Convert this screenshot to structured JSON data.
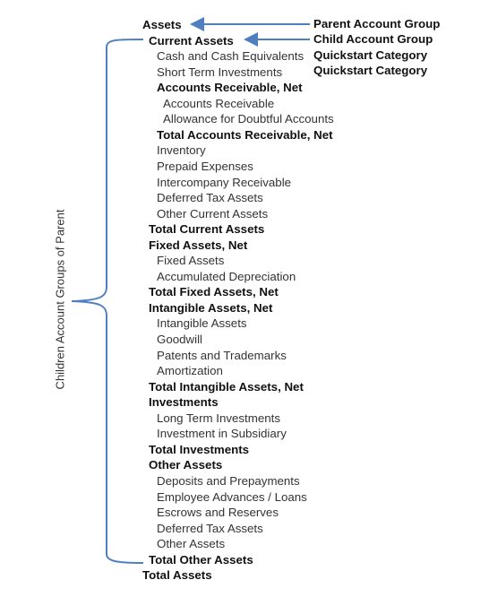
{
  "annotations": {
    "parent": "Parent Account Group",
    "child": "Child Account Group",
    "quickstart1": "Quickstart Category",
    "quickstart2": "Quickstart Category",
    "bracket_label": "Children Account Groups of Parent"
  },
  "accent_color": "#4f7fbf",
  "rows": [
    {
      "text": "Assets",
      "level": 0,
      "bold": true
    },
    {
      "text": "Current Assets",
      "level": 1,
      "bold": true
    },
    {
      "text": "Cash and Cash Equivalents",
      "level": 2,
      "bold": false
    },
    {
      "text": "Short Term Investments",
      "level": 2,
      "bold": false
    },
    {
      "text": "Accounts Receivable, Net",
      "level": 2,
      "bold": true
    },
    {
      "text": "Accounts Receivable",
      "level": 3,
      "bold": false
    },
    {
      "text": "Allowance for Doubtful Accounts",
      "level": 3,
      "bold": false
    },
    {
      "text": "Total Accounts Receivable, Net",
      "level": 2,
      "bold": true
    },
    {
      "text": "Inventory",
      "level": 2,
      "bold": false
    },
    {
      "text": "Prepaid Expenses",
      "level": 2,
      "bold": false
    },
    {
      "text": "Intercompany Receivable",
      "level": 2,
      "bold": false
    },
    {
      "text": "Deferred Tax Assets",
      "level": 2,
      "bold": false
    },
    {
      "text": "Other Current Assets",
      "level": 2,
      "bold": false
    },
    {
      "text": "Total Current Assets",
      "level": 1,
      "bold": true
    },
    {
      "text": "Fixed Assets, Net",
      "level": 1,
      "bold": true
    },
    {
      "text": "Fixed Assets",
      "level": 2,
      "bold": false
    },
    {
      "text": "Accumulated Depreciation",
      "level": 2,
      "bold": false
    },
    {
      "text": "Total Fixed Assets, Net",
      "level": 1,
      "bold": true
    },
    {
      "text": "Intangible Assets, Net",
      "level": 1,
      "bold": true
    },
    {
      "text": "Intangible Assets",
      "level": 2,
      "bold": false
    },
    {
      "text": "Goodwill",
      "level": 2,
      "bold": false
    },
    {
      "text": "Patents and Trademarks",
      "level": 2,
      "bold": false
    },
    {
      "text": "Amortization",
      "level": 2,
      "bold": false
    },
    {
      "text": "Total Intangible Assets, Net",
      "level": 1,
      "bold": true
    },
    {
      "text": "Investments",
      "level": 1,
      "bold": true
    },
    {
      "text": "Long Term Investments",
      "level": 2,
      "bold": false
    },
    {
      "text": "Investment in Subsidiary",
      "level": 2,
      "bold": false
    },
    {
      "text": "Total Investments",
      "level": 1,
      "bold": true
    },
    {
      "text": "Other Assets",
      "level": 1,
      "bold": true
    },
    {
      "text": "Deposits and Prepayments",
      "level": 2,
      "bold": false
    },
    {
      "text": "Employee Advances / Loans",
      "level": 2,
      "bold": false
    },
    {
      "text": "Escrows and Reserves",
      "level": 2,
      "bold": false
    },
    {
      "text": "Deferred Tax Assets",
      "level": 2,
      "bold": false
    },
    {
      "text": "Other Assets",
      "level": 2,
      "bold": false
    },
    {
      "text": "Total Other Assets",
      "level": 1,
      "bold": true
    },
    {
      "text": "Total Assets",
      "level": 0,
      "bold": true
    }
  ]
}
